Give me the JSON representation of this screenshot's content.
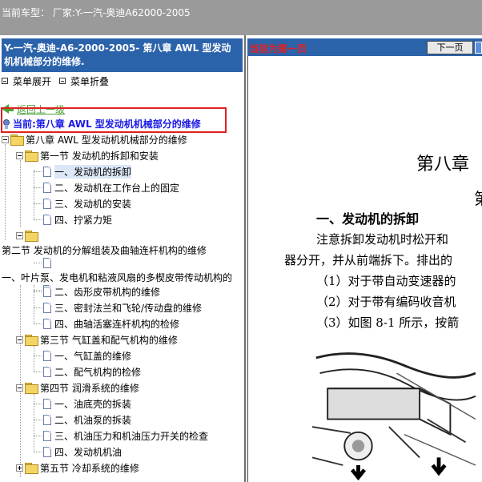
{
  "topbar": {
    "model_text": "当前车型： 厂家:Y-一汽-奥迪A62000-2005"
  },
  "left_panel": {
    "title": "Y-一汽-奥迪-A6-2000-2005- 第八章 AWL 型发动机机械部分的维修.",
    "expand_label": "菜单展开",
    "collapse_label": "菜单折叠",
    "back_label": "返回上一级",
    "current_label": "当前:第八章 AWL 型发动机机械部分的维修"
  },
  "tree": {
    "root": "第八章 AWL 型发动机机械部分的维修",
    "section1": "第一节 发动机的拆卸和安装",
    "s1_items": [
      "一、发动机的拆卸",
      "二、发动机在工作台上的固定",
      "三、发动机的安装",
      "四、拧紧力矩"
    ],
    "section2": "第二节 发动机的分解组装及曲轴连杆机构的维修",
    "section2b": "一、叶片泵、发电机和粘液风扇的多楔皮带传动机构的",
    "s2_items": [
      "二、齿形皮带机构的维修",
      "三、密封法兰和飞轮/传动盘的维修",
      "四、曲轴活塞连杆机构的检修"
    ],
    "section3": "第三节 气缸盖和配气机构的维修",
    "s3_items": [
      "一、气缸盖的维修",
      "二、配气机构的检修"
    ],
    "section4": "第四节 润滑系统的维修",
    "s4_items": [
      "一、油底壳的拆装",
      "二、机油泵的拆装",
      "三、机油压力和机油压力开关的检查",
      "四、发动机机油"
    ],
    "section5": "第五节 冷却系统的维修"
  },
  "right_panel": {
    "page_status": "当前为第一页",
    "next_button": "下一页",
    "chapter_title": "第八章",
    "chapter_title_cont": "第",
    "section_heading": "一、发动机的拆卸",
    "paragraphs": [
      "注意拆卸发动机时松开和",
      "器分开，并从前端拆下。排出的",
      "（1）对于带自动变速器的",
      "（2）对于带有编码收音机",
      "（3）如图 8-1 所示，按箭"
    ]
  },
  "colors": {
    "accent_blue": "#2b63ab",
    "highlight_red": "#e02020",
    "link_green": "#4aa33b",
    "topbar_gray": "#9a9a9a"
  }
}
